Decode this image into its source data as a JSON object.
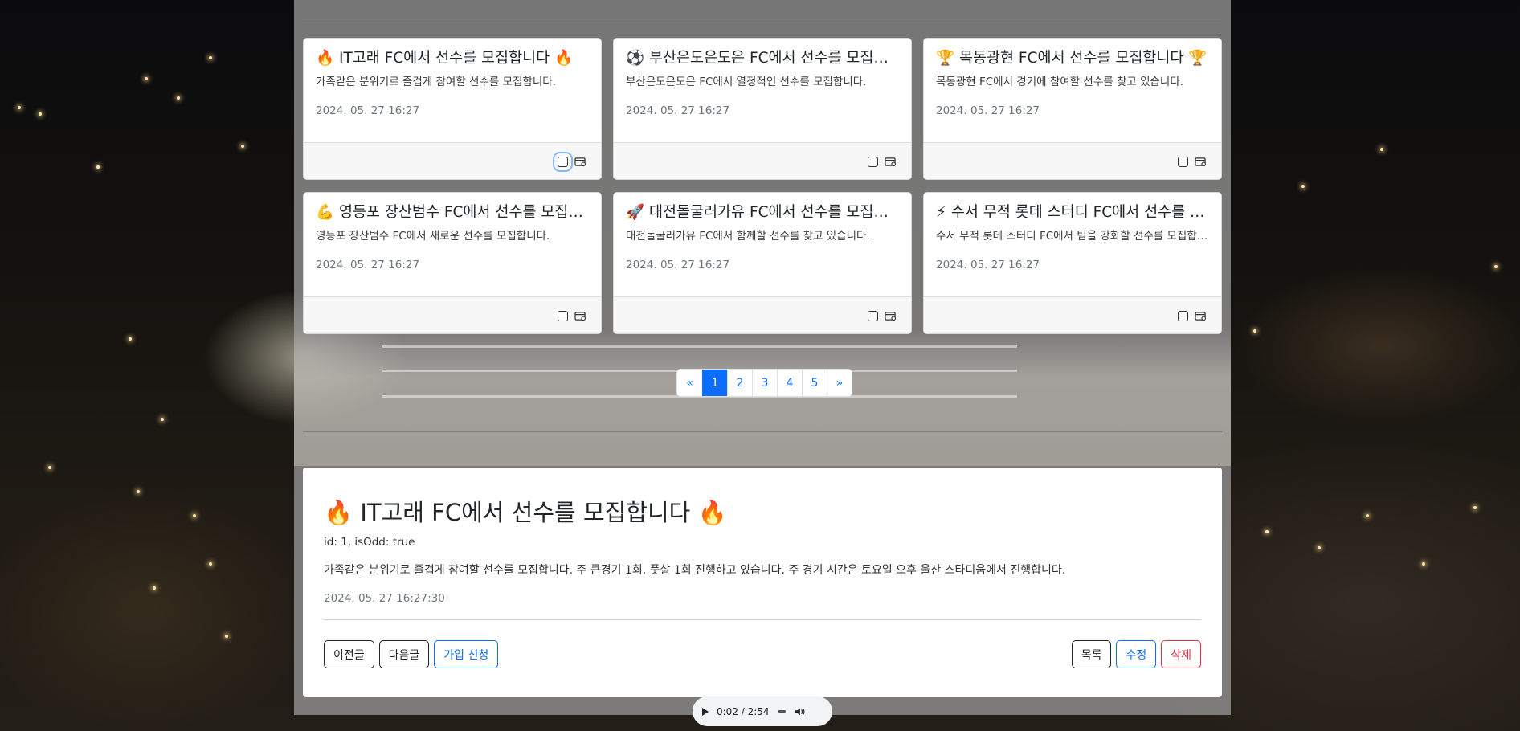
{
  "cards": [
    {
      "emoji": "🔥",
      "title": "IT고래 FC에서 선수를 모집합니다 🔥",
      "text": "가족같은 분위기로 즐겁게 참여할 선수를 모집합니다.",
      "date": "2024. 05. 27 16:27"
    },
    {
      "emoji": "⚽",
      "title": "부산은도은도은 FC에서 선수를 모집합니다",
      "text": "부산은도은도은 FC에서 열정적인 선수를 모집합니다.",
      "date": "2024. 05. 27 16:27"
    },
    {
      "emoji": "🏆",
      "title": "목동광현 FC에서 선수를 모집합니다 🏆",
      "text": "목동광현 FC에서 경기에 참여할 선수를 찾고 있습니다.",
      "date": "2024. 05. 27 16:27"
    },
    {
      "emoji": "💪",
      "title": "영등포 장산범수 FC에서 선수를 모집합니다",
      "text": "영등포 장산범수 FC에서 새로운 선수를 모집합니다.",
      "date": "2024. 05. 27 16:27"
    },
    {
      "emoji": "🚀",
      "title": "대전돌굴러가유 FC에서 선수를 모집합니다",
      "text": "대전돌굴러가유 FC에서 함께할 선수를 찾고 있습니다.",
      "date": "2024. 05. 27 16:27"
    },
    {
      "emoji": "⚡",
      "title": "수서 무적 롯데 스터디 FC에서 선수를 모집합니다",
      "text": "수서 무적 롯데 스터디 FC에서 팀을 강화할 선수를 모집합니다.",
      "date": "2024. 05. 27 16:27"
    }
  ],
  "pagination": {
    "prev": "«",
    "pages": [
      "1",
      "2",
      "3",
      "4",
      "5"
    ],
    "active": "1",
    "next": "»"
  },
  "detail": {
    "title": "🔥 IT고래 FC에서 선수를 모집합니다 🔥",
    "meta": "id: 1, isOdd: true",
    "content": "가족같은 분위기로 즐겁게 참여할 선수를 모집합니다. 주 큰경기 1회, 풋살 1회 진행하고 있습니다. 주 경기 시간은 토요일 오후 울산 스타디움에서 진행합니다.",
    "date": "2024. 05. 27 16:27:30"
  },
  "buttons": {
    "prev": "이전글",
    "next": "다음글",
    "join": "가입 신청",
    "list": "목록",
    "edit": "수정",
    "delete": "삭제"
  },
  "audio": {
    "time": "0:02 / 2:54"
  },
  "colors": {
    "primary": "#0d6efd",
    "danger": "#dc3545",
    "dark": "#212529"
  }
}
